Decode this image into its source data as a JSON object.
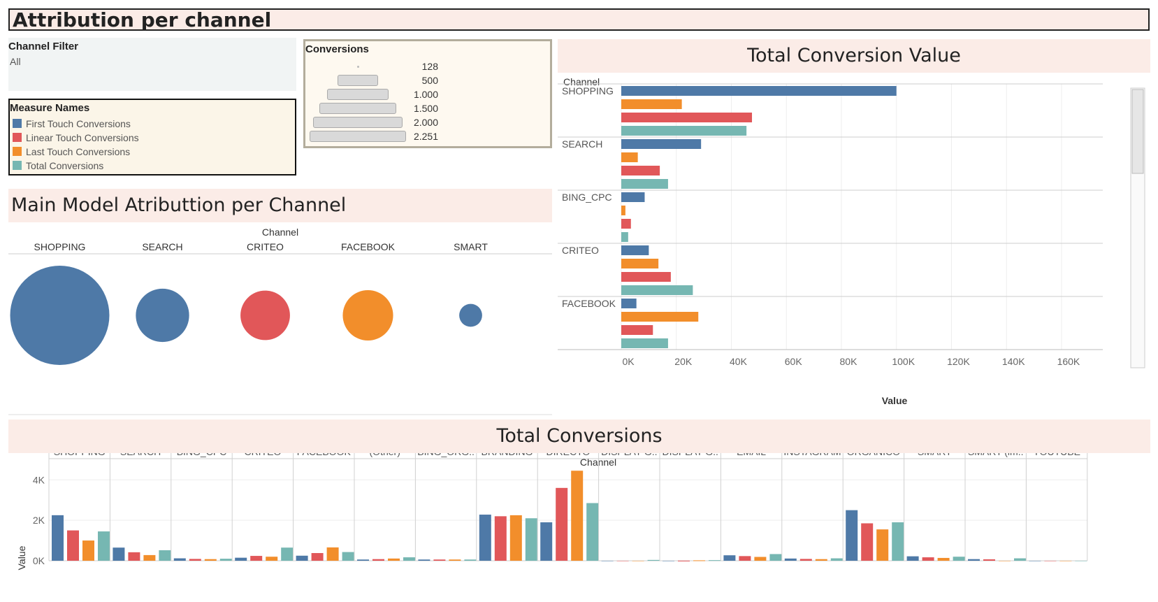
{
  "title": "Attribution per channel",
  "channel_filter": {
    "label": "Channel Filter",
    "value": "All"
  },
  "measure_legend": {
    "label": "Measure Names",
    "items": [
      {
        "label": "First Touch Conversions",
        "color": "#4e79a7"
      },
      {
        "label": "Linear Touch Conversions",
        "color": "#e15759"
      },
      {
        "label": "Last Touch Conversions",
        "color": "#f28e2b"
      },
      {
        "label": "Total Conversions",
        "color": "#76b7b2"
      }
    ]
  },
  "conversions_legend": {
    "label": "Conversions",
    "sizes": [
      "128",
      "500",
      "1.000",
      "1.500",
      "2.000",
      "2.251"
    ]
  },
  "main_model": {
    "header": "Main Model Atributtion per Channel",
    "axis_label": "Channel",
    "chart_data": {
      "type": "scatter",
      "title": "Main Model Atributtion per Channel",
      "categories": [
        "SHOPPING",
        "SEARCH",
        "CRITEO",
        "FACEBOOK",
        "SMART"
      ],
      "values": [
        2251,
        650,
        560,
        580,
        120
      ],
      "measure": [
        "First Touch Conversions",
        "First Touch Conversions",
        "Linear Touch Conversions",
        "Last Touch Conversions",
        "First Touch Conversions"
      ]
    }
  },
  "total_conversion_value": {
    "header": "Total Conversion Value",
    "chart_data": {
      "type": "bar",
      "title": "Total Conversion Value",
      "ylabel": "Channel",
      "xlabel": "Value",
      "xlim": [
        0,
        175000
      ],
      "ticks": [
        "0K",
        "20K",
        "40K",
        "60K",
        "80K",
        "100K",
        "120K",
        "140K",
        "160K"
      ],
      "categories": [
        "SHOPPING",
        "SEARCH",
        "BING_CPC",
        "CRITEO",
        "FACEBOOK"
      ],
      "series": [
        {
          "name": "First Touch Conversions",
          "values": [
            100000,
            29000,
            8500,
            10000,
            5500
          ]
        },
        {
          "name": "Last Touch Conversions",
          "values": [
            22000,
            6000,
            1500,
            13500,
            28000
          ]
        },
        {
          "name": "Linear Touch Conversions",
          "values": [
            47500,
            14000,
            3500,
            18000,
            11500
          ]
        },
        {
          "name": "Total Conversions",
          "values": [
            45500,
            17000,
            2500,
            26000,
            17000
          ]
        }
      ]
    }
  },
  "total_conversions": {
    "header": "Total Conversions",
    "chart_data": {
      "type": "bar",
      "title": "Total Conversions",
      "xlabel": "Channel",
      "ylabel": "Value",
      "ylim": [
        0,
        4700
      ],
      "ticks": [
        "0K",
        "2K",
        "4K"
      ],
      "categories": [
        "SHOPPING",
        "SEARCH",
        "BING_CPC",
        "CRITEO",
        "FACEBOOK",
        "(Other)",
        "BING_ORG..",
        "BRANDING",
        "DIRECTO",
        "DISPLAY G..",
        "DISPLAY G..",
        "EMAIL",
        "INSTAGRAM",
        "ORGANICO",
        "SMART",
        "SMART (im..",
        "YOUTUBE"
      ],
      "series": [
        {
          "name": "First Touch Conversions",
          "values": [
            2251,
            650,
            120,
            150,
            250,
            60,
            60,
            2280,
            1900,
            0,
            0,
            270,
            110,
            2500,
            220,
            80,
            0
          ]
        },
        {
          "name": "Linear Touch Conversions",
          "values": [
            1500,
            420,
            90,
            240,
            380,
            80,
            60,
            2200,
            3600,
            0,
            5,
            230,
            90,
            1850,
            170,
            70,
            0
          ]
        },
        {
          "name": "Last Touch Conversions",
          "values": [
            1000,
            280,
            80,
            200,
            660,
            110,
            60,
            2250,
            4450,
            0,
            20,
            190,
            80,
            1550,
            140,
            0,
            0
          ]
        },
        {
          "name": "Total Conversions",
          "values": [
            1450,
            520,
            100,
            650,
            430,
            170,
            60,
            2100,
            2850,
            40,
            30,
            330,
            120,
            1900,
            200,
            120,
            0
          ]
        }
      ]
    }
  }
}
